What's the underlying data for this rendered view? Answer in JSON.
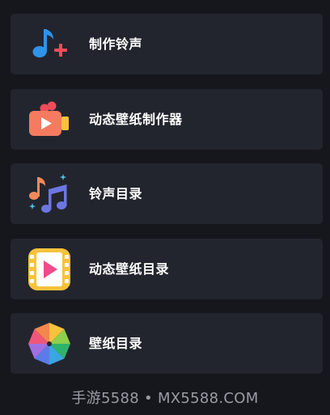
{
  "menu": {
    "items": [
      {
        "label": "制作铃声",
        "icon": "music-note-plus-icon"
      },
      {
        "label": "动态壁纸制作器",
        "icon": "video-camera-icon"
      },
      {
        "label": "铃声目录",
        "icon": "music-notes-icon"
      },
      {
        "label": "动态壁纸目录",
        "icon": "film-play-icon"
      },
      {
        "label": "壁纸目录",
        "icon": "color-wheel-icon"
      }
    ]
  },
  "watermark": {
    "text": "手游5588 • MX5588.COM"
  },
  "colors": {
    "background": "#16171d",
    "card": "#23252e",
    "label": "#ffffff",
    "watermark": "#9a9ca3"
  }
}
